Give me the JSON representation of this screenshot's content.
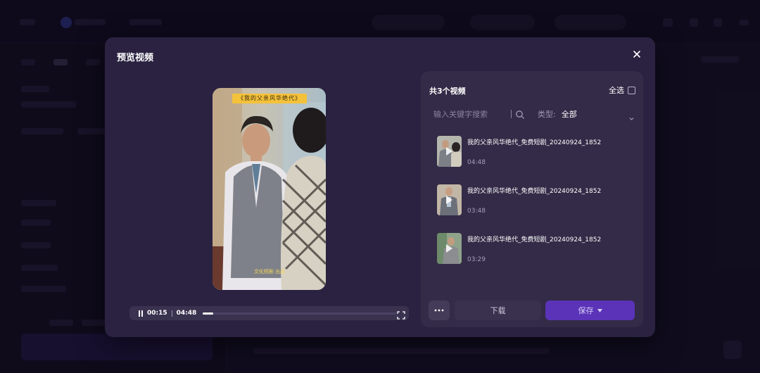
{
  "modal": {
    "title": "预览视频",
    "close_icon": "close-icon"
  },
  "preview": {
    "overlay_top_text": "《我的父亲风华绝代》",
    "overlay_bottom_text": "文化短剧 出品"
  },
  "player": {
    "current_time": "00:15",
    "total_time": "04:48",
    "progress": 0.052
  },
  "panel": {
    "title": "共3个视频",
    "select_all_label": "全选",
    "search_placeholder": "输入关键字搜索",
    "type_label": "类型:",
    "type_value": "全部",
    "items": [
      {
        "title": "我的父亲风华绝代_免费短剧_20240924_18520...",
        "duration": "04:48"
      },
      {
        "title": "我的父亲风华绝代_免费短剧_20240924_18520...",
        "duration": "03:48"
      },
      {
        "title": "我的父亲风华绝代_免费短剧_20240924_18520...",
        "duration": "03:29"
      }
    ],
    "download_label": "下载",
    "save_label": "保存"
  },
  "colors": {
    "modal_bg": "#2a2240",
    "panel_bg": "#332b47",
    "accent": "#5b33b8"
  }
}
